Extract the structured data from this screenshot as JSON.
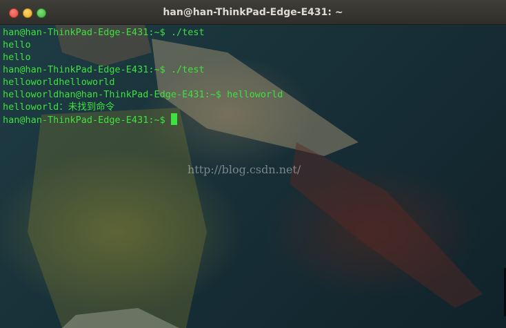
{
  "window": {
    "title": "han@han-ThinkPad-Edge-E431: ~"
  },
  "terminal": {
    "lines": [
      "han@han-ThinkPad-Edge-E431:~$ ./test",
      "hello",
      "hello",
      "han@han-ThinkPad-Edge-E431:~$ ./test",
      "helloworldhelloworld",
      "helloworldhan@han-ThinkPad-Edge-E431:~$ helloworld",
      "helloworld：未找到命令",
      "han@han-ThinkPad-Edge-E431:~$ "
    ],
    "text_color": "#3ee23e"
  },
  "watermark": "http://blog.csdn.net/",
  "icons": {
    "close": "close-icon",
    "minimize": "minimize-icon",
    "maximize": "maximize-icon"
  }
}
